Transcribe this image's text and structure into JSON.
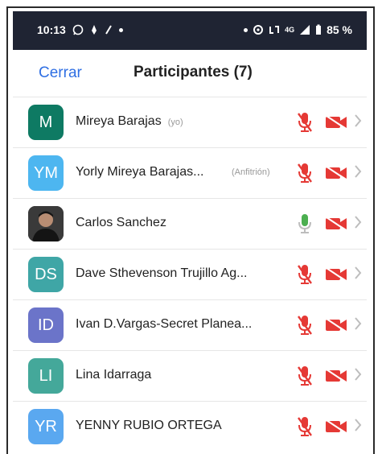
{
  "status_bar": {
    "time": "10:13",
    "network": "4G",
    "battery": "85 %"
  },
  "header": {
    "close_label": "Cerrar",
    "title": "Participantes (7)"
  },
  "colors": {
    "accent": "#2f6fe3",
    "muted_red": "#e53935",
    "mic_on_green": "#4caf50"
  },
  "participants": [
    {
      "initials": "M",
      "name": "Mireya Barajas",
      "tag": "(yo)",
      "color": "#0e7a63",
      "mic": "muted",
      "video": "off"
    },
    {
      "initials": "YM",
      "name": "Yorly Mireya Barajas...",
      "tag": "(Anfitrión)",
      "color": "#4db6f0",
      "mic": "muted",
      "video": "off"
    },
    {
      "initials": "",
      "name": "Carlos Sanchez",
      "tag": "",
      "color": "#2b2b2b",
      "mic": "on",
      "video": "off"
    },
    {
      "initials": "DS",
      "name": "Dave Sthevenson Trujillo Ag...",
      "tag": "",
      "color": "#3fa6a6",
      "mic": "muted",
      "video": "off"
    },
    {
      "initials": "ID",
      "name": "Ivan D.Vargas-Secret Planea...",
      "tag": "",
      "color": "#6b74c9",
      "mic": "muted",
      "video": "off"
    },
    {
      "initials": "LI",
      "name": "Lina Idarraga",
      "tag": "",
      "color": "#44a89a",
      "mic": "muted",
      "video": "off"
    },
    {
      "initials": "YR",
      "name": "YENNY RUBIO ORTEGA",
      "tag": "",
      "color": "#5aa8f0",
      "mic": "muted",
      "video": "off"
    }
  ]
}
